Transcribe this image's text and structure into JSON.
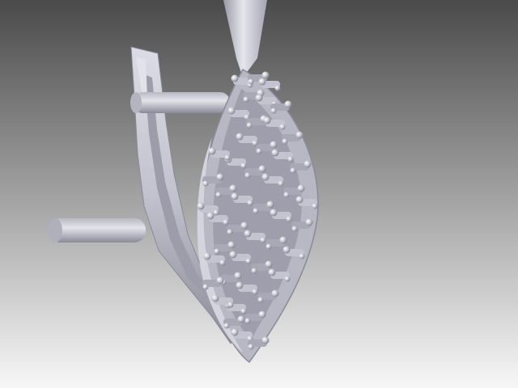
{
  "viewport": {
    "background_top": "#4a4a4a",
    "background_bottom": "#f7f7f7"
  },
  "model": {
    "subject": "earring-3d-render",
    "metal_color": "#c9c9d3",
    "shadow_color": "#8f8f9c",
    "highlight_color": "#f4f4f8"
  }
}
